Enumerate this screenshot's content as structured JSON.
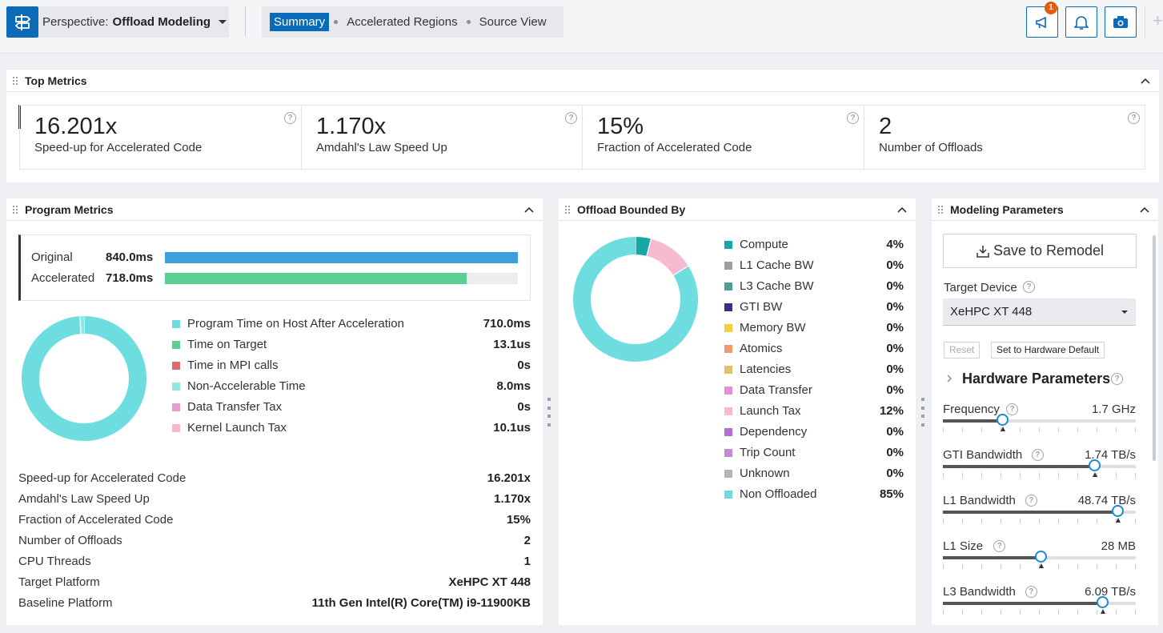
{
  "toolbar": {
    "perspective_prefix": "Perspective:",
    "perspective_value": "Offload Modeling",
    "tabs": [
      {
        "label": "Summary",
        "active": true
      },
      {
        "label": "Accelerated Regions",
        "active": false
      },
      {
        "label": "Source View",
        "active": false
      }
    ],
    "notification_badge": "1",
    "plus": "+"
  },
  "top_metrics": {
    "title": "Top Metrics",
    "cards": [
      {
        "value": "16.201x",
        "label": "Speed-up for Accelerated Code"
      },
      {
        "value": "1.170x",
        "label": "Amdahl's Law Speed Up"
      },
      {
        "value": "15%",
        "label": "Fraction of Accelerated Code"
      },
      {
        "value": "2",
        "label": "Number of Offloads"
      }
    ]
  },
  "program_metrics": {
    "title": "Program Metrics",
    "bars": [
      {
        "label": "Original",
        "value": "840.0ms",
        "fraction": 1.0,
        "color": "#3ca0dc"
      },
      {
        "label": "Accelerated",
        "value": "718.0ms",
        "fraction": 0.855,
        "color": "#5ccf95"
      }
    ],
    "legend": [
      {
        "label": "Program Time on Host After Acceleration",
        "value": "710.0ms",
        "color": "#6edde0",
        "share": 98.9
      },
      {
        "label": "Time on Target",
        "value": "13.1us",
        "color": "#5ccf95",
        "share": 0
      },
      {
        "label": "Time in MPI calls",
        "value": "0s",
        "color": "#e06a6a",
        "share": 0
      },
      {
        "label": "Non-Accelerable Time",
        "value": "8.0ms",
        "color": "#8fe8e3",
        "share": 1.1
      },
      {
        "label": "Data Transfer Tax",
        "value": "0s",
        "color": "#e79ad4",
        "share": 0
      },
      {
        "label": "Kernel Launch Tax",
        "value": "10.1us",
        "color": "#f7b7cc",
        "share": 0
      }
    ],
    "details": [
      {
        "label": "Speed-up for Accelerated Code",
        "value": "16.201x"
      },
      {
        "label": "Amdahl's Law Speed Up",
        "value": "1.170x"
      },
      {
        "label": "Fraction of Accelerated Code",
        "value": "15%"
      },
      {
        "label": "Number of Offloads",
        "value": "2"
      },
      {
        "label": "CPU Threads",
        "value": "1"
      },
      {
        "label": "Target Platform",
        "value": "XeHPC XT 448"
      },
      {
        "label": "Baseline Platform",
        "value": "11th Gen Intel(R) Core(TM) i9-11900KB"
      }
    ]
  },
  "offload_bounded": {
    "title": "Offload Bounded By",
    "legend": [
      {
        "label": "Compute",
        "value": "4%",
        "color": "#17a7a8",
        "share": 4
      },
      {
        "label": "L1 Cache BW",
        "value": "0%",
        "color": "#9e9e9e",
        "share": 0
      },
      {
        "label": "L3 Cache BW",
        "value": "0%",
        "color": "#4c9d92",
        "share": 0
      },
      {
        "label": "GTI BW",
        "value": "0%",
        "color": "#3b2f8c",
        "share": 0
      },
      {
        "label": "Memory BW",
        "value": "0%",
        "color": "#f7cf3c",
        "share": 0
      },
      {
        "label": "Atomics",
        "value": "0%",
        "color": "#f39a6b",
        "share": 0
      },
      {
        "label": "Latencies",
        "value": "0%",
        "color": "#e3c36a",
        "share": 0
      },
      {
        "label": "Data Transfer",
        "value": "0%",
        "color": "#e58fd8",
        "share": 0
      },
      {
        "label": "Launch Tax",
        "value": "12%",
        "color": "#f8bad0",
        "share": 12
      },
      {
        "label": "Dependency",
        "value": "0%",
        "color": "#b66ad8",
        "share": 0
      },
      {
        "label": "Trip Count",
        "value": "0%",
        "color": "#c38bd6",
        "share": 0
      },
      {
        "label": "Unknown",
        "value": "0%",
        "color": "#b4b4b4",
        "share": 0
      },
      {
        "label": "Non Offloaded",
        "value": "85%",
        "color": "#6edde0",
        "share": 84
      }
    ]
  },
  "modeling": {
    "title": "Modeling Parameters",
    "save_label": "Save to Remodel",
    "target_device_label": "Target Device",
    "target_device_value": "XeHPC XT 448",
    "reset_label": "Reset",
    "hw_default_label": "Set to Hardware Default",
    "hw_params_label": "Hardware Parameters",
    "sliders": [
      {
        "name": "Frequency",
        "value": "1.7 GHz",
        "level": 0.31,
        "default": 0.31
      },
      {
        "name": "GTI Bandwidth",
        "value": "1.74 TB/s",
        "level": 0.79,
        "default": 0.79
      },
      {
        "name": "L1 Bandwidth",
        "value": "48.74 TB/s",
        "level": 0.91,
        "default": 0.91
      },
      {
        "name": "L1 Size",
        "value": "28 MB",
        "level": 0.51,
        "default": 0.51
      },
      {
        "name": "L3 Bandwidth",
        "value": "6.09 TB/s",
        "level": 0.83,
        "default": 0.83
      }
    ]
  }
}
